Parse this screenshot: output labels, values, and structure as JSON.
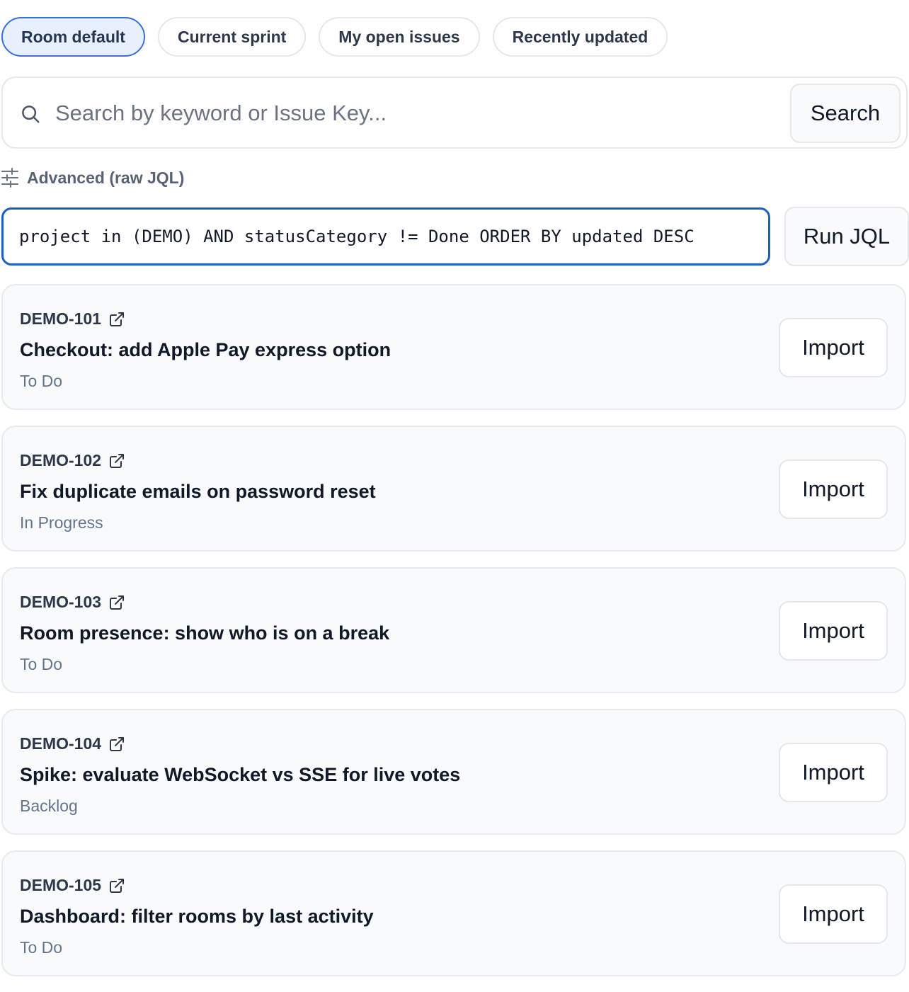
{
  "filters": [
    {
      "label": "Room default",
      "active": true
    },
    {
      "label": "Current sprint",
      "active": false
    },
    {
      "label": "My open issues",
      "active": false
    },
    {
      "label": "Recently updated",
      "active": false
    }
  ],
  "search": {
    "placeholder": "Search by keyword or Issue Key...",
    "value": "",
    "button_label": "Search"
  },
  "advanced": {
    "label": "Advanced (raw JQL)",
    "jql_value": "project in (DEMO) AND statusCategory != Done ORDER BY updated DESC",
    "run_label": "Run JQL"
  },
  "issues": [
    {
      "key": "DEMO-101",
      "title": "Checkout: add Apple Pay express option",
      "status": "To Do",
      "action": "Import"
    },
    {
      "key": "DEMO-102",
      "title": "Fix duplicate emails on password reset",
      "status": "In Progress",
      "action": "Import"
    },
    {
      "key": "DEMO-103",
      "title": "Room presence: show who is on a break",
      "status": "To Do",
      "action": "Import"
    },
    {
      "key": "DEMO-104",
      "title": "Spike: evaluate WebSocket vs SSE for live votes",
      "status": "Backlog",
      "action": "Import"
    },
    {
      "key": "DEMO-105",
      "title": "Dashboard: filter rooms by last activity",
      "status": "To Do",
      "action": "Import"
    }
  ],
  "colors": {
    "accent": "#1c5fc4",
    "active_chip_bg": "#e8f0fd",
    "card_bg": "#f8fafc"
  }
}
